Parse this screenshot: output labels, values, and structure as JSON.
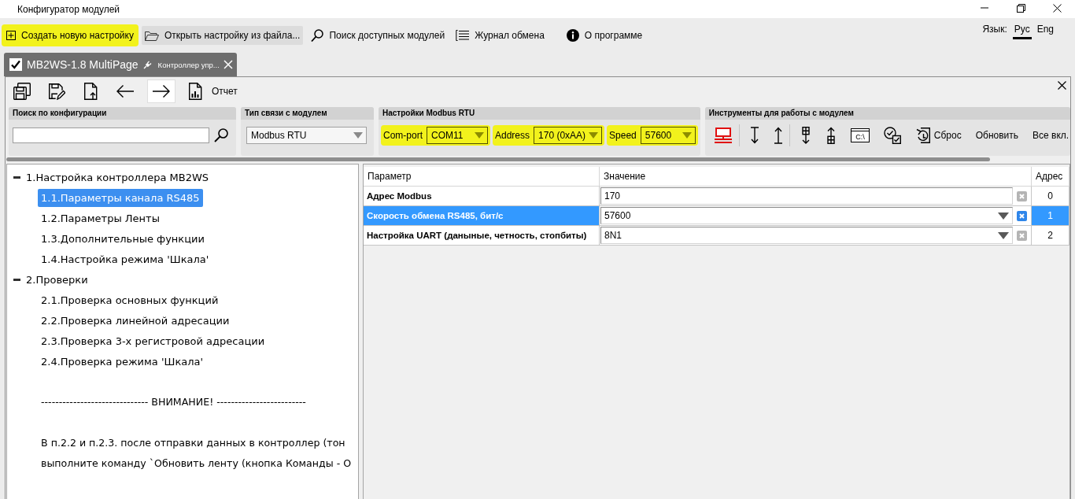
{
  "window": {
    "title": "Конфигуратор модулей"
  },
  "menu": [
    {
      "kind": "new",
      "label": "Создать новую настройку",
      "highlighted": true,
      "hovered": false
    },
    {
      "kind": "open",
      "label": "Открыть настройку из файла...",
      "highlighted": false,
      "hovered": true
    },
    {
      "kind": "search",
      "label": "Поиск доступных модулей",
      "highlighted": false,
      "hovered": false
    },
    {
      "kind": "log",
      "label": "Журнал обмена",
      "highlighted": false,
      "hovered": false
    },
    {
      "kind": "info",
      "label": "О программе",
      "highlighted": false,
      "hovered": false
    }
  ],
  "language": {
    "label": "Язык:",
    "options": [
      {
        "label": "Рус",
        "selected": true
      },
      {
        "label": "Eng",
        "selected": false
      }
    ]
  },
  "document_tabs": [
    {
      "title": "MB2WS-1.8 MultiPage",
      "subtitle": "Контроллер упр...",
      "checked": true,
      "selected": true
    }
  ],
  "toolbar": [
    {
      "kind": "save-all",
      "hovered": false
    },
    {
      "kind": "save-as",
      "hovered": false
    },
    {
      "kind": "export",
      "hovered": false
    },
    {
      "kind": "back",
      "hovered": false
    },
    {
      "kind": "forward",
      "hovered": true
    },
    {
      "kind": "report",
      "label": "Отчет",
      "hovered": false
    }
  ],
  "search_group": {
    "title": "Поиск по конфигурации"
  },
  "connection_group": {
    "title": "Тип связи с модулем",
    "value": "Modbus RTU"
  },
  "modbus_group": {
    "title": "Настройки Modbus RTU",
    "fields": [
      {
        "label": "Com-port",
        "value": "COM11",
        "highlighted": true
      },
      {
        "label": "Address",
        "value": "170 (0xAA)",
        "highlighted": true
      },
      {
        "label": "Speed",
        "value": "57600",
        "highlighted": true
      }
    ]
  },
  "tools_group": {
    "title": "Инструменты для работы с модулем",
    "tools": [
      {
        "kind": "network"
      },
      {
        "kind": "read"
      },
      {
        "kind": "write"
      },
      {
        "kind": "read-table"
      },
      {
        "kind": "write-table"
      },
      {
        "kind": "console",
        "glyph": "C:\\"
      },
      {
        "kind": "check"
      },
      {
        "kind": "reset",
        "label": "Сброс"
      },
      {
        "kind": "text",
        "label": "Обновить"
      },
      {
        "kind": "text",
        "label": "Все вкл."
      }
    ]
  },
  "tree": {
    "items": [
      {
        "label": "1.Настройка контроллера MB2WS",
        "expanded": true,
        "selected": false,
        "children": [
          {
            "label": "1.1.Параметры канала RS485",
            "selected": true
          },
          {
            "label": "1.2.Параметры Ленты",
            "selected": false
          },
          {
            "label": "1.3.Дополнительные функции",
            "selected": false
          },
          {
            "label": "1.4.Настройка режима 'Шкала'",
            "selected": false
          }
        ]
      },
      {
        "label": "2.Проверки",
        "expanded": true,
        "selected": false,
        "children": [
          {
            "label": "2.1.Проверка основных функций",
            "selected": false
          },
          {
            "label": "2.2.Проверка линейной адресации",
            "selected": false
          },
          {
            "label": "2.3.Проверка 3-х регистровой адресации",
            "selected": false
          },
          {
            "label": "2.4.Проверка режима 'Шкала'",
            "selected": false
          }
        ]
      }
    ],
    "notes": [
      {
        "lines": [
          "------------------------------ ВНИМАНИЕ! -------------------------"
        ]
      },
      {
        "lines": [
          "В п.2.2 и п.2.3. после отправки данных в контроллер (тон",
          "выполните команду `Обновить ленту (кнопка Команды - О"
        ]
      }
    ]
  },
  "grid": {
    "columns": [
      "Параметр",
      "Значение",
      "Адрес"
    ],
    "rows": [
      {
        "parameter": "Адрес Modbus",
        "kind": "text",
        "value": "170",
        "address": "0",
        "selected": false
      },
      {
        "parameter": "Скорость обмена RS485, бит/с",
        "kind": "dropdown",
        "value": "57600",
        "address": "1",
        "selected": true
      },
      {
        "parameter": "Настройка UART (даныные, четность, стопбиты)",
        "kind": "dropdown",
        "value": "8N1",
        "address": "2",
        "selected": false
      }
    ]
  }
}
